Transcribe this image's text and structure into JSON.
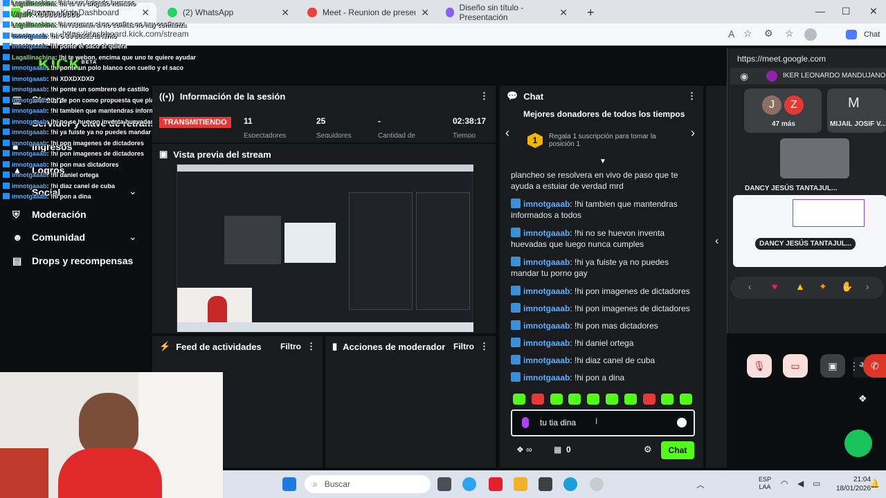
{
  "browser": {
    "tabs": [
      {
        "label": "Stream - Kick Dashboard",
        "icon": "kick-favicon"
      },
      {
        "label": "(2) WhatsApp",
        "icon": "whatsapp-icon"
      },
      {
        "label": "Meet - Reunion de presentaci",
        "icon": "meet-icon"
      },
      {
        "label": "Diseño sin título - Presentación",
        "icon": "canva-icon"
      }
    ],
    "url": "https://dashboard.kick.com/stream",
    "profile_label": "Chat"
  },
  "sidebar": {
    "items": [
      {
        "label": "Stream",
        "icon": "stream-icon"
      },
      {
        "label": "Servidor y clave de retransm",
        "icon": "key-icon"
      },
      {
        "label": "Ingresos",
        "icon": "money-icon"
      },
      {
        "label": "Logros",
        "icon": "trophy-icon"
      },
      {
        "label": "Social",
        "icon": "social-icon"
      },
      {
        "label": "Moderación",
        "icon": "shield-icon"
      },
      {
        "label": "Comunidad",
        "icon": "community-icon"
      },
      {
        "label": "Drops y recompensas",
        "icon": "gift-icon"
      }
    ],
    "logo": "KICK",
    "logo_badge": "BETA"
  },
  "overlay_chat": [
    {
      "user": "Lagallinachina",
      "text": ": !hi tu ere brigado humano",
      "color": "green"
    },
    {
      "user": "MijailV",
      "text": ": XDDDDDDDDD",
      "color": "purple"
    },
    {
      "user": "Lagallinachina",
      "text": ": !hi resumen si no confias no hay confianza",
      "color": "green"
    },
    {
      "user": "imnotgaaab",
      "text": ": !hi o se busca tu lerno",
      "color": "blue"
    },
    {
      "user": "imnotgaaab",
      "text": ": !hi ponte el saco si quiera",
      "color": "blue"
    },
    {
      "user": "Lagallinachina",
      "text": ": !hi te webon, encima que uno te quiere ayudar",
      "color": "green"
    },
    {
      "user": "imnotgaaab",
      "text": ": !hi ponte un polo blanco con cuello y el saco",
      "color": "blue"
    },
    {
      "user": "imnotgaaab",
      "text": ": !hi XDXDXDXD",
      "color": "blue"
    },
    {
      "user": "imnotgaaab",
      "text": ": !hi ponte un sombrero de castillo",
      "color": "blue"
    },
    {
      "user": "imnotgaaab",
      "text": ": !hi oe pon como propuesta que plancheo se resolvera en vivo de paso que te ayuda a estuiar de verdad mrd",
      "color": "blue"
    },
    {
      "user": "imnotgaaab",
      "text": ": !hi tambien que mantendras informados a todos",
      "color": "blue"
    },
    {
      "user": "imnotgaaab",
      "text": ": !hi no se huevon inventa huevadas que luego nunca cumples",
      "color": "blue"
    },
    {
      "user": "imnotgaaab",
      "text": ": !hi ya fuiste ya no puedes mandar tu porno gay",
      "color": "blue"
    },
    {
      "user": "imnotgaaab",
      "text": ": !hi pon imagenes de dictadores",
      "color": "blue"
    },
    {
      "user": "imnotgaaab",
      "text": ": !hi pon imagenes de dictadores",
      "color": "blue"
    },
    {
      "user": "imnotgaaab",
      "text": ": !hi pon mas dictadores",
      "color": "blue"
    },
    {
      "user": "imnotgaaab",
      "text": ": !hi daniel ortega",
      "color": "blue"
    },
    {
      "user": "imnotgaaab",
      "text": ": !hi diaz canel de cuba",
      "color": "blue"
    },
    {
      "user": "imnotgaaab",
      "text": ": !hi pon a dina",
      "color": "blue"
    }
  ],
  "session": {
    "title": "Información de la sesión",
    "status": "TRANSMITIENDO",
    "viewers": "11",
    "viewers_label": "Espectadores",
    "followers": "25",
    "followers_label": "Seguidores",
    "subs": "-",
    "subs_label": "Cantidad de",
    "time": "02:38:17",
    "time_label": "Tiempo"
  },
  "preview": {
    "title": "Vista previa del stream"
  },
  "activity": {
    "title": "Feed de actividades",
    "filter": "Filtro"
  },
  "mod_actions": {
    "title": "Acciones de moderador",
    "filter": "Filtro"
  },
  "chat": {
    "title": "Chat",
    "donors_title": "Mejores donadores de todos los tiempos",
    "donor_rank": "1",
    "donor_text": "Regala 1 suscripción para tomar la posición 1",
    "first_line": "plancheo se resolvera en vivo de paso que te ayuda a estuiar de verdad mrd",
    "messages": [
      {
        "user": "imnotgaaab",
        "text": ": !hi tambien que mantendras informados a todos"
      },
      {
        "user": "imnotgaaab",
        "text": ": !hi no se huevon inventa huevadas que luego nunca cumples"
      },
      {
        "user": "imnotgaaab",
        "text": ": !hi ya fuiste ya no puedes mandar tu porno gay"
      },
      {
        "user": "imnotgaaab",
        "text": ": !hi pon imagenes de dictadores"
      },
      {
        "user": "imnotgaaab",
        "text": ": !hi pon imagenes de dictadores"
      },
      {
        "user": "imnotgaaab",
        "text": ": !hi pon mas dictadores"
      },
      {
        "user": "imnotgaaab",
        "text": ": !hi daniel ortega"
      },
      {
        "user": "imnotgaaab",
        "text": ": !hi diaz canel de cuba"
      },
      {
        "user": "imnotgaaab",
        "text": ": !hi pon a dina"
      }
    ],
    "input_value": "tu tia dina ",
    "points": "0",
    "send_label": "Chat"
  },
  "meet": {
    "url": "https://meet.google.com",
    "participant_main": "IKER LEONARDO MANDUJANO G",
    "more_count": "47 más",
    "participant_2": "MIJAIL JOSIF V...",
    "avatar_j": "J",
    "avatar_z": "Z",
    "avatar_m": "M",
    "tile_name_1": "DANCY JESÚS TANTAJUL...",
    "tile_name_2": "DANCY JESÚS TANTAJUL..."
  },
  "taskbar": {
    "search_placeholder": "Buscar",
    "lang": "ESP",
    "lang2": "LAA",
    "time": "21:04",
    "date": "18/01/2026"
  },
  "colors": {
    "kick_green": "#53fc18",
    "live_red": "#e53935",
    "chat_user": "#5ab0ff",
    "meet_bg": "#202124"
  }
}
